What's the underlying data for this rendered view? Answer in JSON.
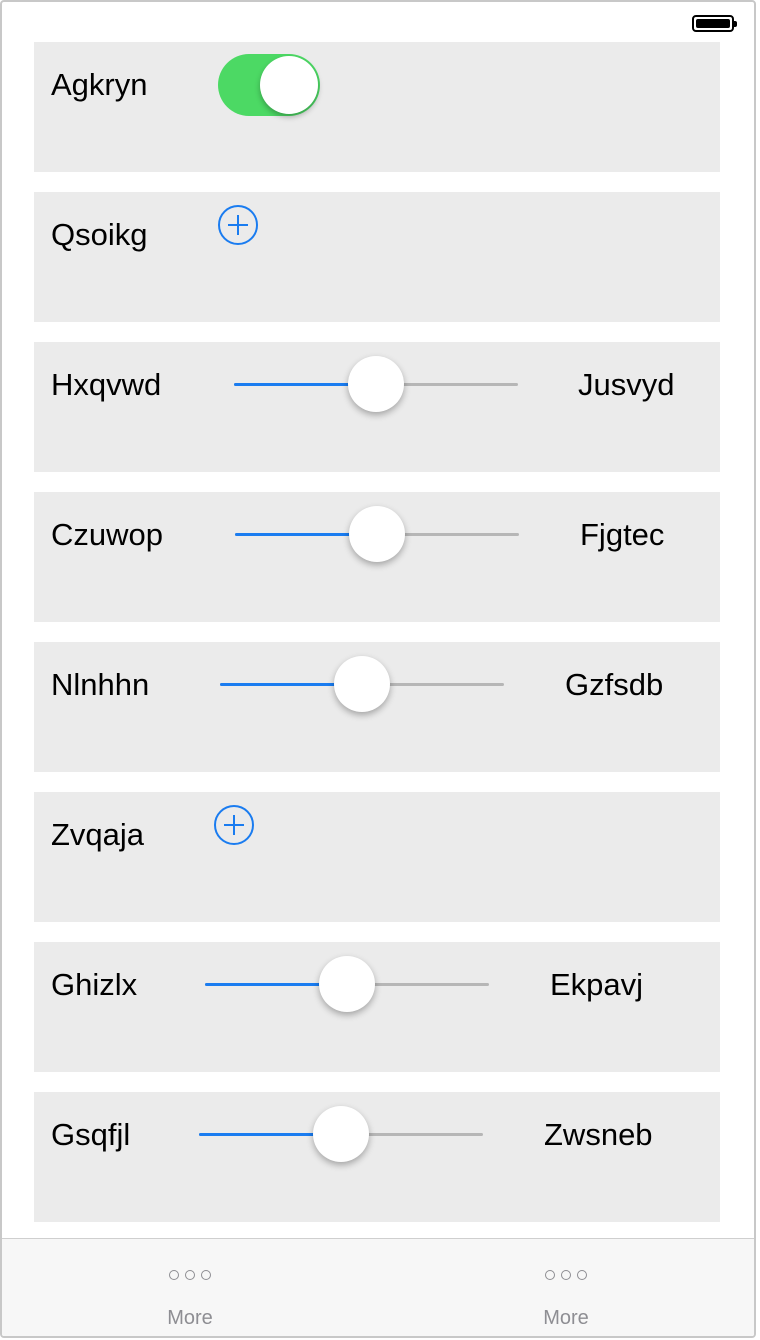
{
  "status_bar": {
    "battery_icon": "battery-full-icon"
  },
  "rows": [
    {
      "type": "toggle",
      "label": "Agkryn",
      "on": true,
      "accent": "#4cd964"
    },
    {
      "type": "add",
      "label": "Qsoikg",
      "accent": "#1a7cf0"
    },
    {
      "type": "slider",
      "label": "Hxqvwd",
      "right_label": "Jusvyd",
      "value": 0.5
    },
    {
      "type": "slider",
      "label": "Czuwop",
      "right_label": "Fjgtec",
      "value": 0.5
    },
    {
      "type": "slider",
      "label": "Nlnhhn",
      "right_label": "Gzfsdb",
      "value": 0.5
    },
    {
      "type": "add",
      "label": "Zvqaja",
      "accent": "#1a7cf0"
    },
    {
      "type": "slider",
      "label": "Ghizlx",
      "right_label": "Ekpavj",
      "value": 0.5
    },
    {
      "type": "slider",
      "label": "Gsqfjl",
      "right_label": "Zwsneb",
      "value": 0.5
    }
  ],
  "tab_bar": {
    "tabs": [
      {
        "label": "More",
        "icon": "more-dots-icon"
      },
      {
        "label": "More",
        "icon": "more-dots-icon"
      }
    ]
  }
}
